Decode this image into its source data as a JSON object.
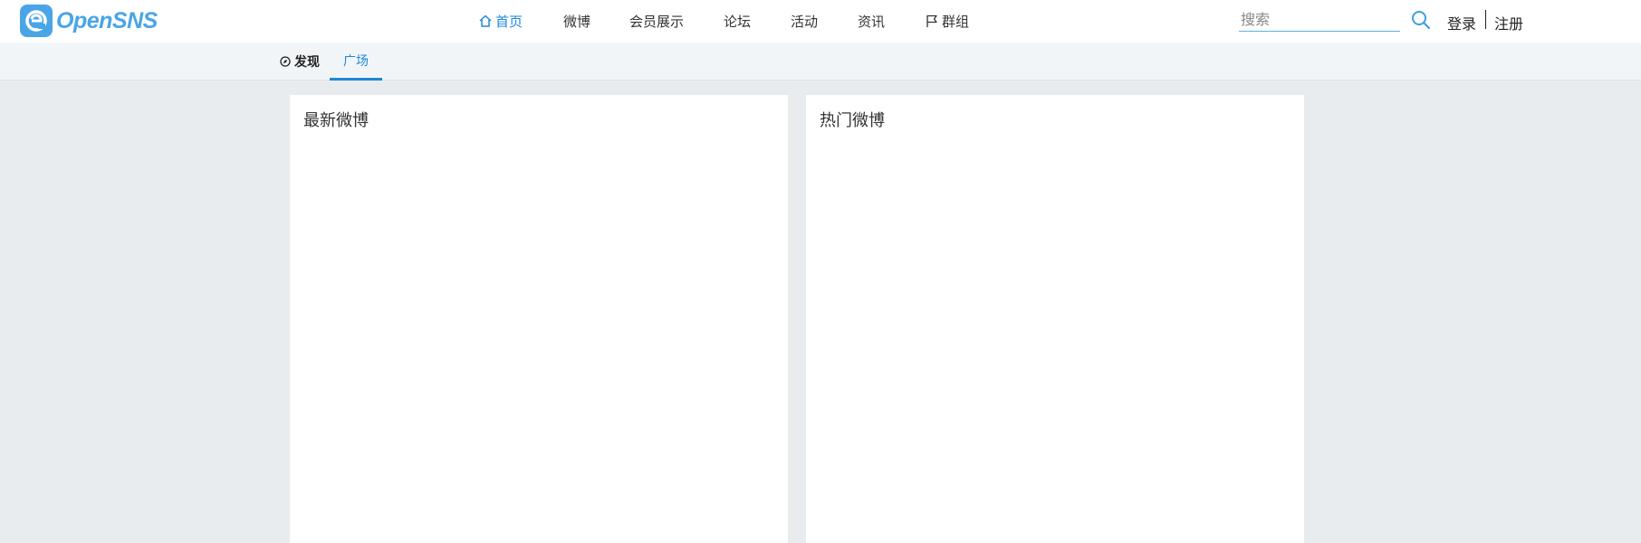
{
  "brand": {
    "name": "OpenSNS",
    "color": "#4aa5e6"
  },
  "nav": {
    "items": [
      {
        "label": "首页",
        "icon": "home-icon",
        "active": true
      },
      {
        "label": "微博"
      },
      {
        "label": "会员展示"
      },
      {
        "label": "论坛"
      },
      {
        "label": "活动"
      },
      {
        "label": "资讯"
      },
      {
        "label": "群组",
        "icon": "flag-icon"
      }
    ],
    "active_color": "#1e88d6"
  },
  "search": {
    "placeholder": "搜索",
    "icon": "search-icon"
  },
  "auth": {
    "login": "登录",
    "register": "注册"
  },
  "subnav": {
    "title": "发现",
    "title_icon": "compass-icon",
    "tabs": [
      {
        "label": "广场",
        "active": true
      }
    ]
  },
  "panels": {
    "latest": {
      "title": "最新微博"
    },
    "hot": {
      "title": "热门微博"
    }
  }
}
